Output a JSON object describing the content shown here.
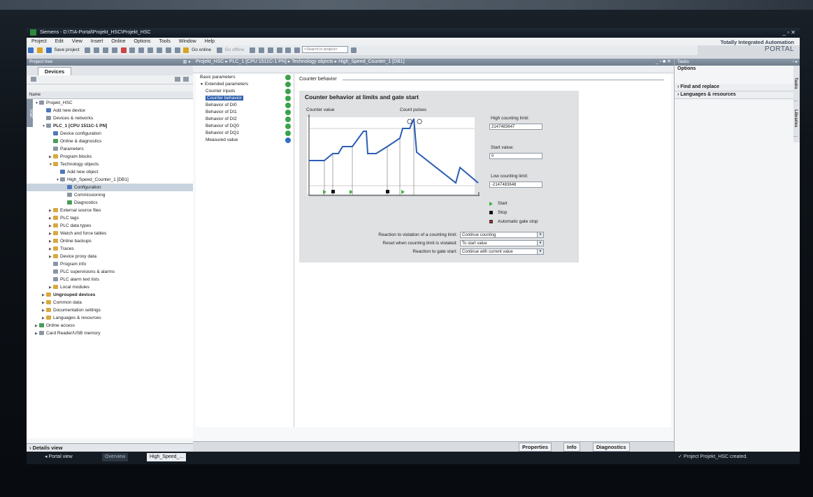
{
  "window": {
    "title": "Siemens - D:\\TIA-Portal\\Projekt_HSC\\Projekt_HSC",
    "controls": "_ ▫ ✕"
  },
  "menu": [
    "Project",
    "Edit",
    "View",
    "Insert",
    "Online",
    "Options",
    "Tools",
    "Window",
    "Help"
  ],
  "brand": {
    "line1": "Totally Integrated Automation",
    "line2": "PORTAL"
  },
  "toolbar": {
    "save_label": "Save project",
    "go_online": "Go online",
    "go_offline": "Go offline",
    "search_placeholder": "<Search in project>"
  },
  "project_tree": {
    "header": "Project tree",
    "tab": "Devices",
    "column_name": "Name",
    "start_strip": "Start",
    "items": [
      {
        "label": "Projekt_HSC",
        "level": 0,
        "icon": "project-icon",
        "arrow": "▼"
      },
      {
        "label": "Add new device",
        "level": 1,
        "icon": "add-device-icon",
        "arrow": ""
      },
      {
        "label": "Devices & networks",
        "level": 1,
        "icon": "network-icon",
        "arrow": ""
      },
      {
        "label": "PLC_1 [CPU 1511C-1 PN]",
        "level": 1,
        "icon": "plc-icon",
        "arrow": "▼",
        "bold": true
      },
      {
        "label": "Device configuration",
        "level": 2,
        "icon": "device-config-icon",
        "arrow": ""
      },
      {
        "label": "Online & diagnostics",
        "level": 2,
        "icon": "diagnostics-icon",
        "arrow": ""
      },
      {
        "label": "Parameters",
        "level": 2,
        "icon": "parameters-icon",
        "arrow": ""
      },
      {
        "label": "Program blocks",
        "level": 2,
        "icon": "folder-icon",
        "arrow": "▶"
      },
      {
        "label": "Technology objects",
        "level": 2,
        "icon": "folder-icon",
        "arrow": "▼"
      },
      {
        "label": "Add new object",
        "level": 3,
        "icon": "add-object-icon",
        "arrow": ""
      },
      {
        "label": "High_Speed_Counter_1 [DB1]",
        "level": 3,
        "icon": "counter-icon",
        "arrow": "▼"
      },
      {
        "label": "Configuration",
        "level": 4,
        "icon": "configuration-icon",
        "arrow": "",
        "selected": true
      },
      {
        "label": "Commissioning",
        "level": 4,
        "icon": "commissioning-icon",
        "arrow": ""
      },
      {
        "label": "Diagnostics",
        "level": 4,
        "icon": "diagnostics-icon",
        "arrow": ""
      },
      {
        "label": "External source files",
        "level": 2,
        "icon": "folder-icon",
        "arrow": "▶"
      },
      {
        "label": "PLC tags",
        "level": 2,
        "icon": "folder-icon",
        "arrow": "▶"
      },
      {
        "label": "PLC data types",
        "level": 2,
        "icon": "folder-icon",
        "arrow": "▶"
      },
      {
        "label": "Watch and force tables",
        "level": 2,
        "icon": "folder-icon",
        "arrow": "▶"
      },
      {
        "label": "Online backups",
        "level": 2,
        "icon": "folder-icon",
        "arrow": "▶"
      },
      {
        "label": "Traces",
        "level": 2,
        "icon": "folder-icon",
        "arrow": "▶"
      },
      {
        "label": "Device proxy data",
        "level": 2,
        "icon": "folder-icon",
        "arrow": "▶"
      },
      {
        "label": "Program info",
        "level": 2,
        "icon": "info-icon",
        "arrow": ""
      },
      {
        "label": "PLC supervisions & alarms",
        "level": 2,
        "icon": "alarm-icon",
        "arrow": ""
      },
      {
        "label": "PLC alarm text lists",
        "level": 2,
        "icon": "text-list-icon",
        "arrow": ""
      },
      {
        "label": "Local modules",
        "level": 2,
        "icon": "folder-icon",
        "arrow": "▶"
      },
      {
        "label": "Ungrouped devices",
        "level": 1,
        "icon": "folder-icon",
        "arrow": "▶",
        "bold": true
      },
      {
        "label": "Common data",
        "level": 1,
        "icon": "folder-icon",
        "arrow": "▶"
      },
      {
        "label": "Documentation settings",
        "level": 1,
        "icon": "folder-icon",
        "arrow": "▶"
      },
      {
        "label": "Languages & resources",
        "level": 1,
        "icon": "folder-icon",
        "arrow": "▶"
      },
      {
        "label": "Online access",
        "level": 0,
        "icon": "online-icon",
        "arrow": "▶"
      },
      {
        "label": "Card Reader/USB memory",
        "level": 0,
        "icon": "card-icon",
        "arrow": "▶"
      }
    ],
    "details_view": "Details view"
  },
  "editor": {
    "breadcrumb": [
      "Projekt_HSC",
      "PLC_1 [CPU 1511C-1 PN]",
      "Technology objects",
      "High_Speed_Counter_1 [DB1]"
    ],
    "nav": [
      {
        "label": "Basic parameters",
        "sub": false,
        "status": "ok"
      },
      {
        "label": "Extended parameters",
        "sub": false,
        "status": "ok",
        "arrow": "▼"
      },
      {
        "label": "Counter inputs",
        "sub": true,
        "status": "ok"
      },
      {
        "label": "Counter behavior",
        "sub": true,
        "status": "ok",
        "selected": true
      },
      {
        "label": "Behavior of DI0",
        "sub": true,
        "status": "ok"
      },
      {
        "label": "Behavior of DI1",
        "sub": true,
        "status": "ok"
      },
      {
        "label": "Behavior of DI2",
        "sub": true,
        "status": "ok"
      },
      {
        "label": "Behavior of DQ0",
        "sub": true,
        "status": "ok"
      },
      {
        "label": "Behavior of DQ1",
        "sub": true,
        "status": "ok"
      },
      {
        "label": "Measured value",
        "sub": true,
        "status": "info"
      }
    ],
    "section_title": "Counter behavior",
    "card_title": "Counter behavior at limits and gate start",
    "graph": {
      "y_label": "Counter value",
      "pulse_label": "Count pulses",
      "t_label": "t"
    },
    "high_limit_label": "High counting limit:",
    "high_limit_value": "2147483647",
    "start_value_label": "Start value:",
    "start_value": "0",
    "low_limit_label": "Low counting limit:",
    "low_limit_value": "-2147483648",
    "legend": [
      {
        "label": "Start",
        "color": "#3fae3a",
        "shape": "triangle"
      },
      {
        "label": "Stop",
        "color": "#111111",
        "shape": "square"
      },
      {
        "label": "Automatic gate stop",
        "color": "#b3262a",
        "shape": "square"
      }
    ],
    "reactions": [
      {
        "label": "Reaction to violation of a counting limit:",
        "value": "Continue counting"
      },
      {
        "label": "Reset when counting limit is violated:",
        "value": "To start value"
      },
      {
        "label": "Reaction to gate start:",
        "value": "Continue with current value"
      }
    ]
  },
  "inspector_tabs": [
    "Properties",
    "Info",
    "Diagnostics"
  ],
  "tasks": {
    "header": "Tasks",
    "options": "Options",
    "sections": [
      "Find and replace",
      "Languages & resources"
    ],
    "vertical_tabs": [
      "Tasks",
      "Libraries"
    ]
  },
  "statusbar": {
    "portal_view": "Portal view",
    "overview": "Overview",
    "open_editor": "High_Speed_...",
    "message": "Project Projekt_HSC created."
  },
  "colors": {
    "accent": "#2f5fae",
    "curve": "#2b5db5",
    "ok": "#3aa34a"
  }
}
